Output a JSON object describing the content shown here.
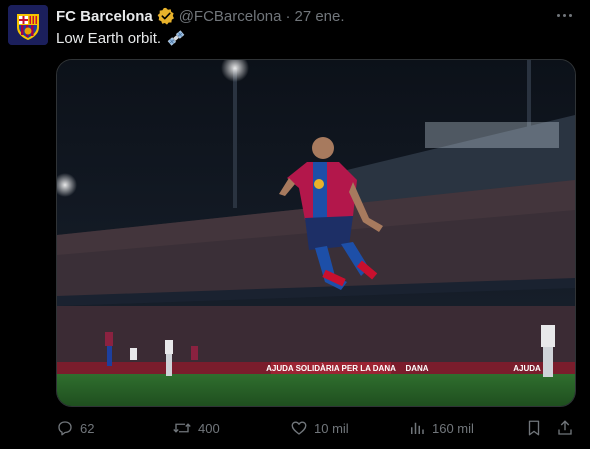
{
  "account": {
    "display_name": "FC Barcelona",
    "handle": "@FCBarcelona",
    "separator": "·",
    "date": "27 ene."
  },
  "tweet": {
    "text": "Low Earth orbit.",
    "emoji_icon": "satellite-icon"
  },
  "media": {
    "banner_text": "AJUDA SOLIDÀRIA PER LA DANA",
    "board_left": "DANA",
    "board_right": "AJUDA",
    "colors": {
      "shirt_blue": "#1d4fa8",
      "shirt_red": "#b3174b",
      "pitch": "#2b6a2a"
    }
  },
  "actions": {
    "replies": "62",
    "reposts": "400",
    "likes": "10 mil",
    "views": "160 mil"
  },
  "colors": {
    "verified": "#e8b22b",
    "muted": "#71767b",
    "text": "#e7e9ea"
  }
}
